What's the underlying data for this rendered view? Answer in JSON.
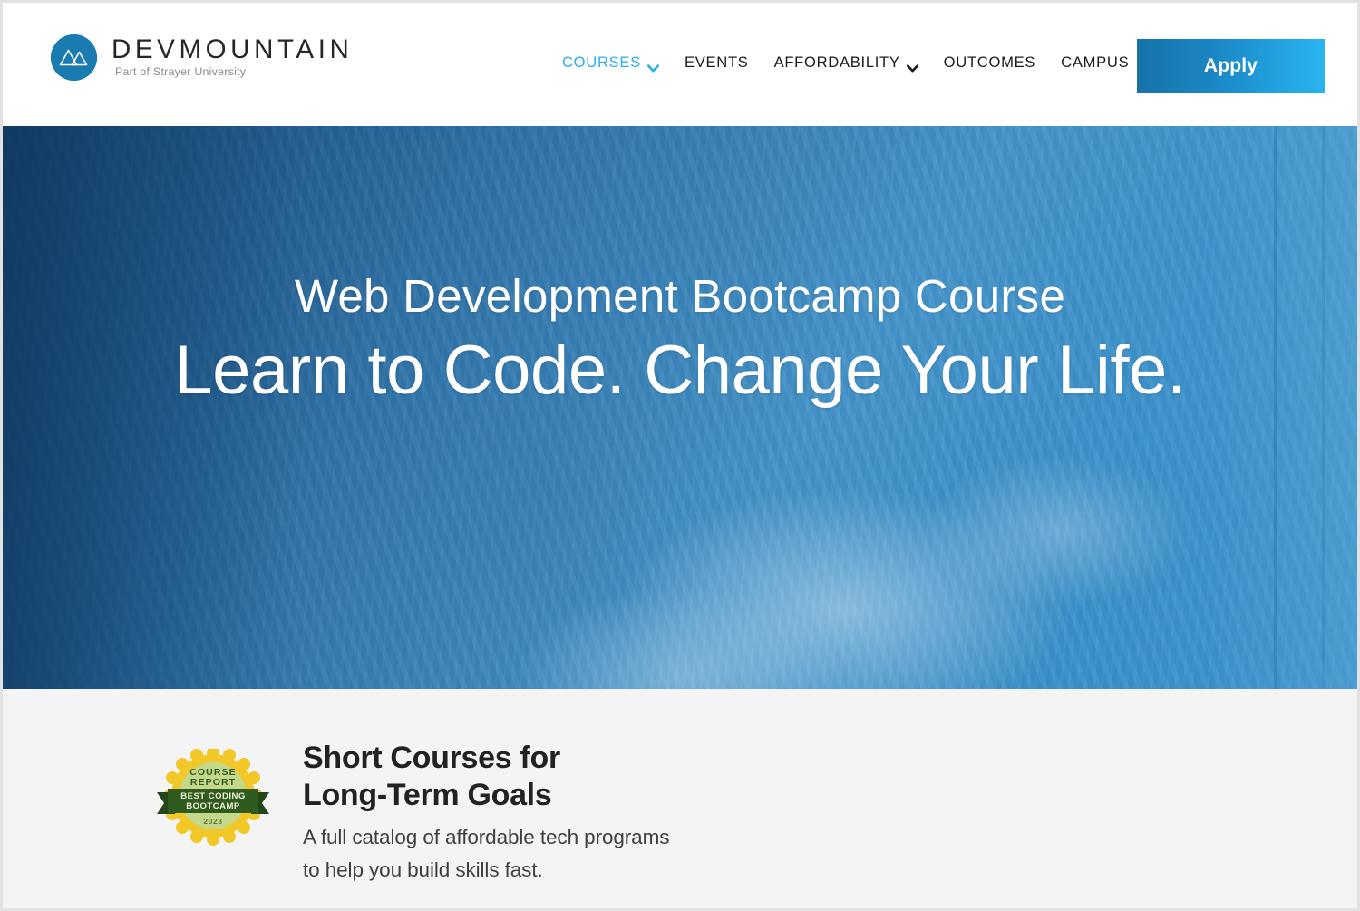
{
  "brand": {
    "wordmark": "DEVMOUNTAIN",
    "tagline": "Part of Strayer University",
    "logo_icon": "mountain-logo-icon",
    "logo_bg_color": "#1a7bb0"
  },
  "nav": {
    "items": [
      {
        "label": "COURSES",
        "has_dropdown": true,
        "active": true
      },
      {
        "label": "EVENTS",
        "has_dropdown": false,
        "active": false
      },
      {
        "label": "AFFORDABILITY",
        "has_dropdown": true,
        "active": false
      },
      {
        "label": "OUTCOMES",
        "has_dropdown": false,
        "active": false
      },
      {
        "label": "CAMPUS",
        "has_dropdown": false,
        "active": false
      }
    ],
    "active_color": "#29b0ef",
    "default_color": "#1b1b1b"
  },
  "cta": {
    "apply_label": "Apply",
    "gradient_from": "#1673a8",
    "gradient_to": "#29b4f0"
  },
  "hero": {
    "eyebrow": "Web Development Bootcamp Course",
    "headline": "Learn to Code. Change Your Life.",
    "background_image": "hands-typing-on-laptops-photo",
    "overlay_color": "#1e6499",
    "text_color": "#ffffff"
  },
  "promo": {
    "heading": "Short Courses for\nLong-Term Goals",
    "subtext": "A full catalog of affordable tech programs\nto help you build skills fast.",
    "background_color": "#f4f4f4",
    "badge": {
      "icon": "course-report-award-badge-icon",
      "top_line": "COURSE",
      "second_line": "REPORT",
      "ribbon_line_1": "BEST CODING",
      "ribbon_line_2": "BOOTCAMP",
      "year": "2023",
      "burst_color": "#f2c829",
      "disc_color": "#c5d88a",
      "ribbon_color": "#2f5c1e",
      "text_color": "#2f5c1e"
    }
  }
}
